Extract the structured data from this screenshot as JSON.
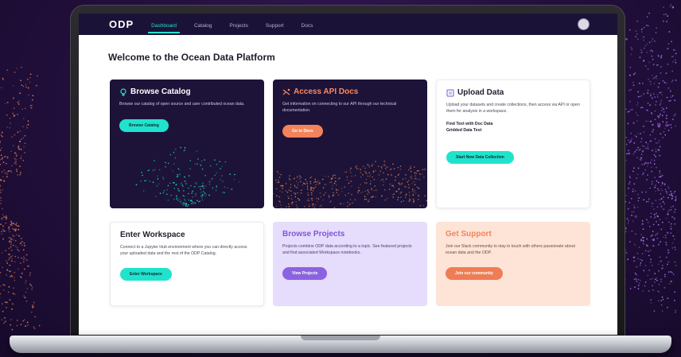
{
  "app": {
    "logo": "ODP",
    "nav": [
      "Dashboard",
      "Catalog",
      "Projects",
      "Support",
      "Docs"
    ],
    "active_nav": "Dashboard"
  },
  "page": {
    "title": "Welcome to the Ocean Data Platform"
  },
  "cards": {
    "catalog": {
      "title": "Browse Catalog",
      "desc": "Browse our catalog of open source and user contributed ocean data.",
      "button": "Browse Catalog"
    },
    "api": {
      "title": "Access API Docs",
      "desc": "Get information on connecting to our API through our technical documentation.",
      "button": "Go to Docs"
    },
    "upload": {
      "title": "Upload Data",
      "desc": "Upload your datasets and create collections, then access via API or open them for analysis in a workspace.",
      "extra1": "Find Text with Doc Data",
      "extra2": "Gridded Data Test",
      "button": "Start New Data Collection"
    },
    "workspace": {
      "title": "Enter Workspace",
      "desc": "Connect to a Jupyter Hub environment where you can directly access your uploaded data and the rest of the ODP Catalog.",
      "button": "Enter Workspace"
    },
    "projects": {
      "title": "Browse Projects",
      "desc": "Projects combine ODP data according to a topic. See featured projects and find associated Workspace notebooks.",
      "button": "View Projects"
    },
    "support": {
      "title": "Get Support",
      "desc": "Join our Slack community to stay in touch with others passionate about ocean data and the ODP.",
      "button": "Join our community"
    }
  },
  "colors": {
    "nav_bg": "#1b1238",
    "teal": "#20e3cd",
    "orange": "#f3835a",
    "purple": "#8b63e0"
  },
  "icons": [
    "catalog-icon",
    "api-icon",
    "upload-icon"
  ]
}
